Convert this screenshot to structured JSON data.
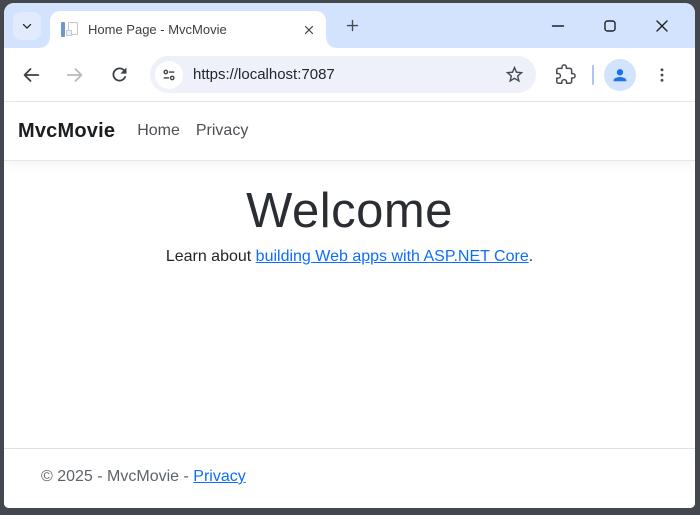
{
  "colors": {
    "tab_strip_bg": "#d3e3fd",
    "active_tab_bg": "#ffffff",
    "toolbar_bg": "#ffffff",
    "omnibox_bg": "#eef1fa",
    "avatar_blue": "#1a73e8",
    "link_blue": "#0d6efd",
    "frame_dark": "#43474e"
  },
  "browser": {
    "tab": {
      "title": "Home Page - MvcMovie"
    },
    "toolbar": {
      "url": "https://localhost:7087"
    },
    "icons": {
      "tab_search": "chevron-down",
      "tab_favicon": "document-page",
      "tab_close": "x",
      "new_tab": "plus",
      "minimize": "horizontal-line",
      "maximize": "square-outline",
      "window_close": "x",
      "back": "arrow-left",
      "forward": "arrow-right",
      "reload": "circular-arrow",
      "site_info": "tune-sliders",
      "bookmark": "star-outline",
      "extensions": "puzzle-piece",
      "profile": "person",
      "menu": "three-dots-vertical"
    }
  },
  "page": {
    "navbar": {
      "brand": "MvcMovie",
      "links": [
        {
          "label": "Home"
        },
        {
          "label": "Privacy"
        }
      ]
    },
    "main": {
      "heading": "Welcome",
      "learn": {
        "prefix": "Learn about ",
        "link_text": "building Web apps with ASP.NET Core",
        "suffix": "."
      }
    },
    "footer": {
      "copyright": "© 2025 - MvcMovie - ",
      "privacy_link": "Privacy"
    }
  }
}
